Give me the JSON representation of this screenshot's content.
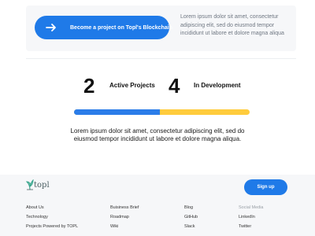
{
  "cta": {
    "button_label": "Become a project on Topl's Blockchain",
    "icon": "arrow-right-icon",
    "text": "Lorem ipsum dolor sit amet, consectetur adipiscing elit, sed do eiusmod tempor incididunt ut labore et dolore magna aliqua"
  },
  "stats": [
    {
      "number": "2",
      "label": "Active Projects"
    },
    {
      "number": "4",
      "label": "In Development"
    }
  ],
  "progress": {
    "fraction": 0.49,
    "colors": {
      "filled": "#2b7de9",
      "remaining": "#ffcc3d"
    }
  },
  "description": "Lorem ipsum dolor sit amet, consectetur adipiscing elit, sed do eiusmod tempor incididunt ut labore et dolore magna aliqua.",
  "footer": {
    "logo_text": "topl",
    "signup_label": "Sign up",
    "columns": [
      {
        "links": [
          "About Us",
          "Technology",
          "Projects Powered by TOPL"
        ]
      },
      {
        "links": [
          "Buisiness Brief",
          "Roadmap",
          "Wiki"
        ]
      },
      {
        "links": [
          "Blog",
          "GitHub",
          "Slack"
        ]
      },
      {
        "heading": "Social Media",
        "links": [
          "LinkedIn",
          "Twitter"
        ]
      }
    ]
  },
  "colors": {
    "accent": "#1f7ae8",
    "progress_yellow": "#ffcc3d",
    "footer_bg": "#f6f7f9"
  }
}
